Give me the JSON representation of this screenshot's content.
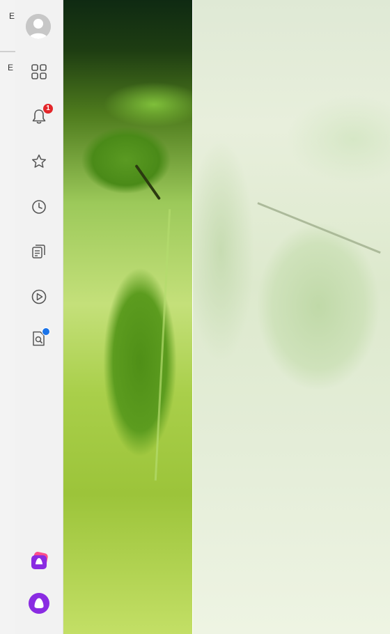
{
  "background_window": {
    "letters": [
      "E",
      "E"
    ]
  },
  "sidebar": {
    "items": [
      {
        "name": "avatar",
        "icon": "user-avatar-icon"
      },
      {
        "name": "apps",
        "icon": "grid-icon"
      },
      {
        "name": "notifications",
        "icon": "bell-icon",
        "badge": "1"
      },
      {
        "name": "favorites",
        "icon": "star-icon"
      },
      {
        "name": "history",
        "icon": "clock-icon"
      },
      {
        "name": "collections",
        "icon": "cards-icon"
      },
      {
        "name": "video",
        "icon": "play-icon"
      },
      {
        "name": "search-doc",
        "icon": "doc-search-icon",
        "dot": true
      },
      {
        "name": "app-stack",
        "icon": "alice-apps-icon"
      },
      {
        "name": "assistant",
        "icon": "alice-assistant-icon"
      }
    ]
  },
  "colors": {
    "sidebar_bg": "#f2f2f2",
    "badge_red": "#e3262a",
    "dot_blue": "#1a73e8",
    "assistant_purple": "#8a2be2"
  }
}
